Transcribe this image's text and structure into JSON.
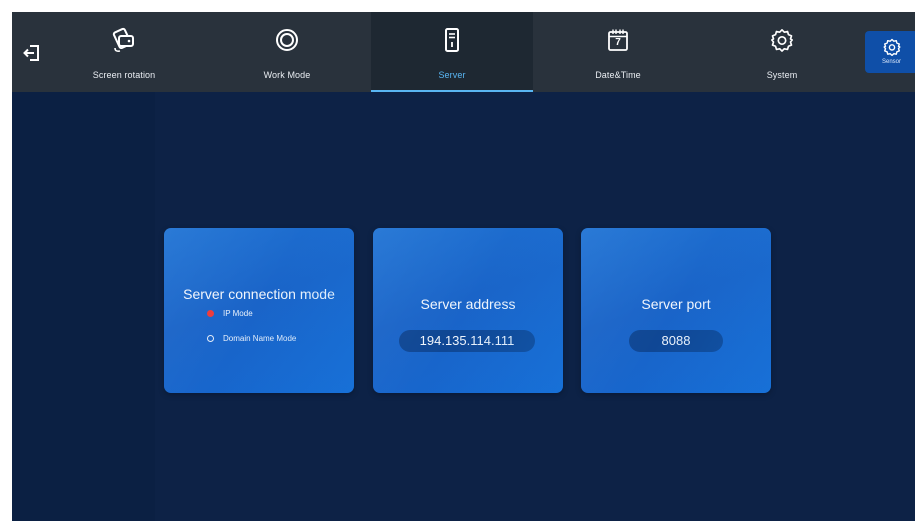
{
  "nav": {
    "tabs": [
      {
        "label": "Screen rotation",
        "icon": "screen-rotation-icon"
      },
      {
        "label": "Work Mode",
        "icon": "work-mode-icon"
      },
      {
        "label": "Server",
        "icon": "server-icon",
        "active": true
      },
      {
        "label": "Date&Time",
        "icon": "calendar-icon",
        "calendar_day": "7"
      },
      {
        "label": "System",
        "icon": "gear-icon"
      }
    ],
    "sensor_button": {
      "label": "Sensor",
      "icon": "sensor-gear-icon"
    }
  },
  "cards": {
    "connection_mode": {
      "title": "Server connection mode",
      "options": [
        {
          "label": "IP Mode",
          "selected": true
        },
        {
          "label": "Domain Name Mode",
          "selected": false
        }
      ]
    },
    "address": {
      "title": "Server address",
      "value": "194.135.114.111"
    },
    "port": {
      "title": "Server port",
      "value": "8088"
    }
  },
  "colors": {
    "background": "#0d2246",
    "topbar": "#29323c",
    "accent": "#59b6f3",
    "card": "#1a64c8",
    "radio_selected": "#ee3a3a",
    "sensor_button": "#0f4fa8"
  }
}
